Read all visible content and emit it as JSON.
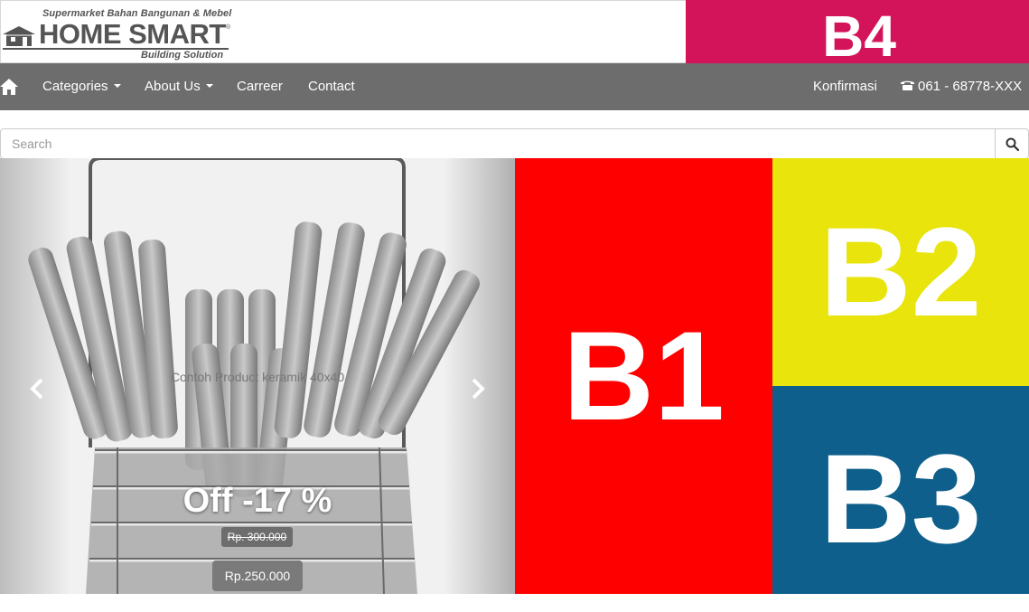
{
  "header": {
    "logo_tagline": "Supermarket Bahan Bangunan & Mebel",
    "logo_name": "HOME SMART",
    "logo_trademark": "®",
    "logo_sub": "Building Solution",
    "banner_b4": "B4"
  },
  "nav": {
    "home_icon": "home-icon",
    "items": [
      {
        "label": "Categories",
        "dropdown": true
      },
      {
        "label": "About Us",
        "dropdown": true
      },
      {
        "label": "Carreer",
        "dropdown": false
      },
      {
        "label": "Contact",
        "dropdown": false
      }
    ],
    "konfirmasi": "Konfirmasi",
    "phone": "061 - 68778-XXX",
    "bg_color": "#6d6d6d"
  },
  "search": {
    "placeholder": "Search",
    "value": ""
  },
  "carousel": {
    "product_title": "Contoh Product keramik 40x40",
    "discount": "Off -17 %",
    "old_price": "Rp. 300.000",
    "new_price": "Rp.250.000"
  },
  "banners": {
    "b1": {
      "label": "B1",
      "color": "#ff0000"
    },
    "b2": {
      "label": "B2",
      "color": "#e8e40c"
    },
    "b3": {
      "label": "B3",
      "color": "#0f5f8c"
    },
    "b4": {
      "label": "B4",
      "color": "#d4145a"
    }
  }
}
